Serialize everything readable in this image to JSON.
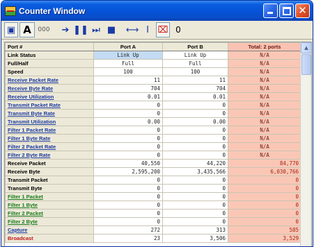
{
  "window": {
    "title": "Counter Window",
    "controls": [
      "minimize-icon",
      "maximize-icon",
      "close-icon"
    ]
  },
  "toolbar": {
    "buttons": [
      {
        "name": "snapshot-icon",
        "glyph": "▣"
      },
      {
        "name": "font-button",
        "glyph": "A"
      },
      {
        "name": "decimal-button",
        "glyph": "000"
      },
      {
        "name": "play-icon",
        "glyph": "➔"
      },
      {
        "name": "pause-icon",
        "glyph": "❚❚"
      },
      {
        "name": "fast-forward-icon",
        "glyph": "⏭"
      },
      {
        "name": "stop-icon",
        "glyph": "■"
      },
      {
        "name": "fit-width-icon",
        "glyph": "⟷"
      },
      {
        "name": "fit-height-icon",
        "glyph": "I"
      },
      {
        "name": "clear-icon",
        "glyph": "⌧"
      },
      {
        "name": "reset-zero-button",
        "glyph": "0"
      }
    ]
  },
  "table": {
    "headers": [
      "Port #",
      "Port A",
      "Port B",
      "Total: 2 ports"
    ],
    "rows": [
      {
        "label": "Link Status",
        "style": "black",
        "a": "Link Up",
        "b": "Link Up",
        "total": "N/A"
      },
      {
        "label": "Full/Half",
        "style": "black",
        "a": "Full",
        "b": "Full",
        "total": "N/A"
      },
      {
        "label": "Speed",
        "style": "black",
        "a": "100",
        "b": "100",
        "total": "N/A"
      },
      {
        "label": "Receive Packet Rate",
        "style": "blue",
        "a": "11",
        "b": "11",
        "total": "N/A"
      },
      {
        "label": "Receive Byte Rate",
        "style": "blue",
        "a": "704",
        "b": "704",
        "total": "N/A"
      },
      {
        "label": "Receive Utilization",
        "style": "blue",
        "a": "0.01",
        "b": "0.01",
        "total": "N/A"
      },
      {
        "label": "Transmit Packet Rate",
        "style": "blue",
        "a": "0",
        "b": "0",
        "total": "N/A"
      },
      {
        "label": "Transmit Byte Rate",
        "style": "blue",
        "a": "0",
        "b": "0",
        "total": "N/A"
      },
      {
        "label": "Transmit Utilization",
        "style": "blue",
        "a": "0.00",
        "b": "0.00",
        "total": "N/A"
      },
      {
        "label": "Filter 1 Packet Rate",
        "style": "blue",
        "a": "0",
        "b": "0",
        "total": "N/A"
      },
      {
        "label": "Filter 1 Byte Rate",
        "style": "blue",
        "a": "0",
        "b": "0",
        "total": "N/A"
      },
      {
        "label": "Filter 2 Packet Rate",
        "style": "blue",
        "a": "0",
        "b": "0",
        "total": "N/A"
      },
      {
        "label": "Filter 2 Byte Rate",
        "style": "blue",
        "a": "0",
        "b": "0",
        "total": "N/A"
      },
      {
        "label": "Receive Packet",
        "style": "black",
        "a": "40,550",
        "b": "44,220",
        "total": "84,770"
      },
      {
        "label": "Receive Byte",
        "style": "black",
        "a": "2,595,200",
        "b": "3,435,566",
        "total": "6,030,766"
      },
      {
        "label": "Transmit Packet",
        "style": "black",
        "a": "0",
        "b": "0",
        "total": "0"
      },
      {
        "label": "Transmit Byte",
        "style": "black",
        "a": "0",
        "b": "0",
        "total": "0"
      },
      {
        "label": "Filter 1 Packet",
        "style": "green",
        "a": "0",
        "b": "0",
        "total": "0"
      },
      {
        "label": "Filter 1 Byte",
        "style": "green",
        "a": "0",
        "b": "0",
        "total": "0"
      },
      {
        "label": "Filter 2 Packet",
        "style": "green",
        "a": "0",
        "b": "0",
        "total": "0"
      },
      {
        "label": "Filter 2 Byte",
        "style": "green",
        "a": "0",
        "b": "0",
        "total": "0"
      },
      {
        "label": "Capture",
        "style": "blue",
        "a": "272",
        "b": "313",
        "total": "585"
      },
      {
        "label": "Broadcast",
        "style": "red",
        "a": "23",
        "b": "3,506",
        "total": "3,529"
      }
    ]
  },
  "colors": {
    "title_bar": "#0553d6",
    "total_column": "#fac7b6",
    "link_status": "#c3dbf3",
    "label_blue": "#1c3aa0",
    "label_green": "#197a19",
    "label_red": "#c01818"
  }
}
